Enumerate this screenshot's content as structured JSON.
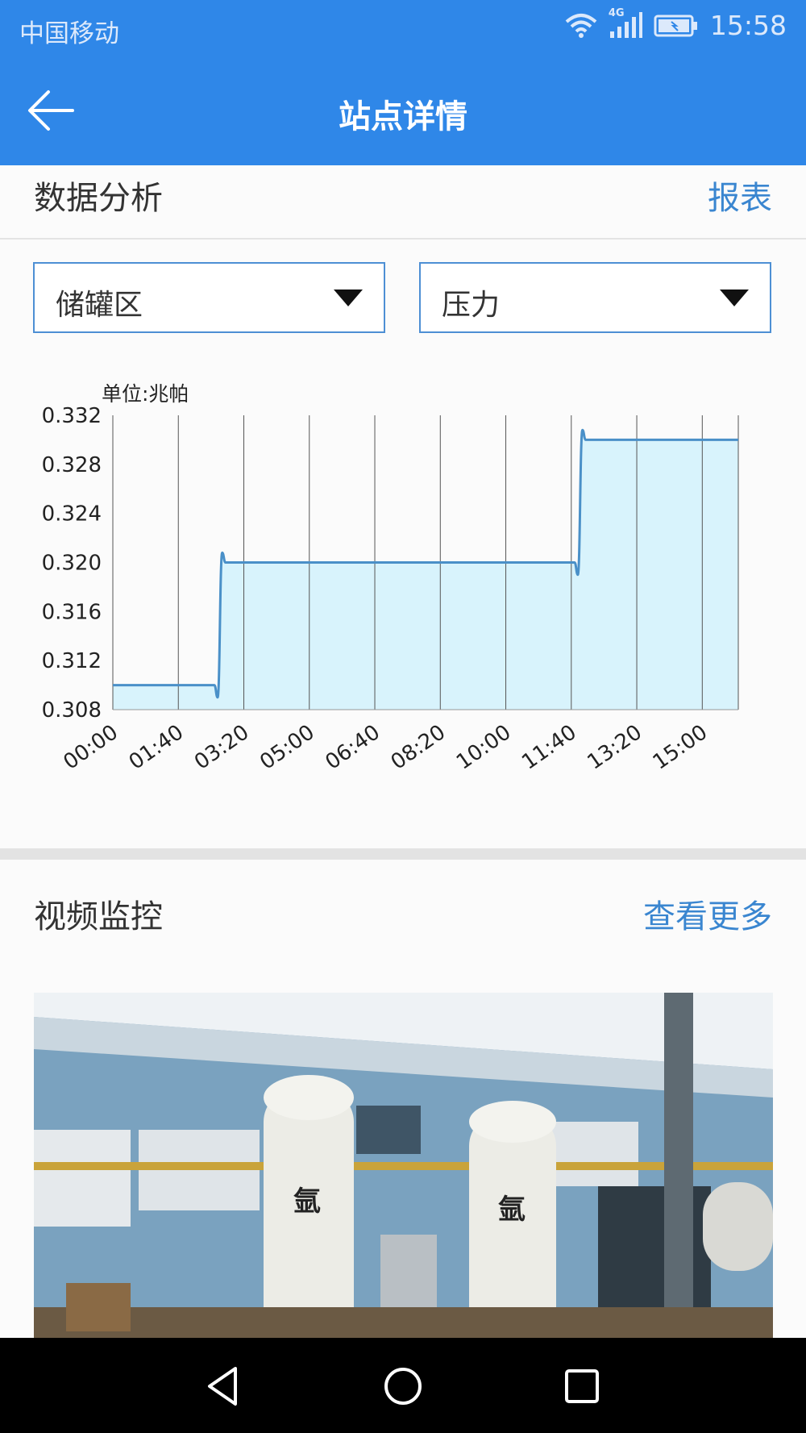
{
  "status_bar": {
    "carrier": "中国移动",
    "network": "4G",
    "time": "15:58",
    "icons": [
      "wifi-icon",
      "signal-icon",
      "battery-charging-icon"
    ]
  },
  "app_bar": {
    "title": "站点详情",
    "back_icon": "back-arrow-icon",
    "color": "#2f87e8"
  },
  "data_analysis": {
    "title": "数据分析",
    "link": "报表",
    "area_select": {
      "value": "储罐区"
    },
    "metric_select": {
      "value": "压力"
    },
    "chart_data": {
      "type": "area",
      "unit_label": "单位:兆帕",
      "x_tick_labels": [
        "00:00",
        "01:40",
        "03:20",
        "05:00",
        "06:40",
        "08:20",
        "10:00",
        "11:40",
        "13:20",
        "15:00"
      ],
      "y_tick_labels": [
        "0.332",
        "0.328",
        "0.324",
        "0.320",
        "0.316",
        "0.312",
        "0.308"
      ],
      "ylim": [
        0.308,
        0.332
      ],
      "xlim_minutes": [
        0,
        955
      ],
      "grid": "vertical",
      "line_color": "#4a90c8",
      "fill_color": "#d8f3fc",
      "points": [
        {
          "x": "00:00",
          "y": 0.31
        },
        {
          "x": "02:35",
          "y": 0.31
        },
        {
          "x": "02:40",
          "y": 0.309
        },
        {
          "x": "02:47",
          "y": 0.3208
        },
        {
          "x": "02:52",
          "y": 0.32
        },
        {
          "x": "11:45",
          "y": 0.32
        },
        {
          "x": "11:50",
          "y": 0.319
        },
        {
          "x": "11:57",
          "y": 0.3308
        },
        {
          "x": "12:02",
          "y": 0.33
        },
        {
          "x": "15:55",
          "y": 0.33
        }
      ]
    }
  },
  "video_monitor": {
    "title": "视频监控",
    "link": "查看更多",
    "tank_label": "氩"
  },
  "nav_bar": {
    "buttons": [
      "back-triangle-icon",
      "home-circle-icon",
      "recents-square-icon"
    ]
  }
}
